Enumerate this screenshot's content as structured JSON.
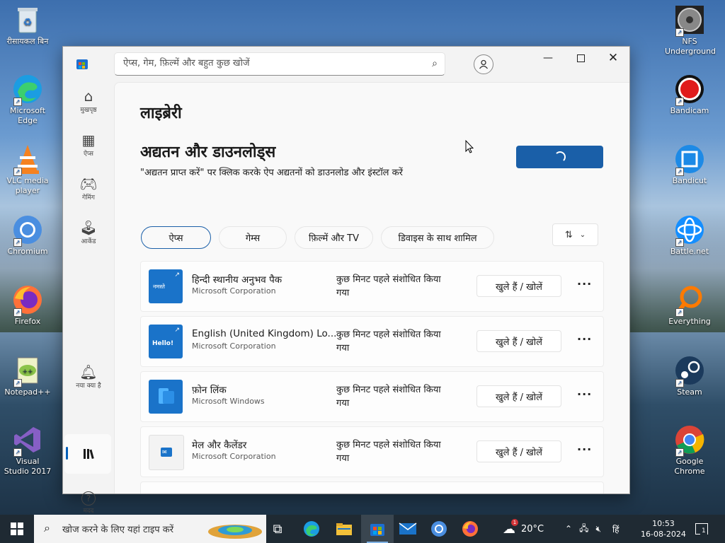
{
  "desktop": {
    "icons_left": [
      {
        "label": "रीसायकल बिन",
        "icon": "recycle-bin-icon"
      },
      {
        "label": "Microsoft Edge",
        "icon": "edge-icon"
      },
      {
        "label": "VLC media player",
        "icon": "vlc-icon"
      },
      {
        "label": "Chromium",
        "icon": "chromium-icon"
      },
      {
        "label": "Firefox",
        "icon": "firefox-icon"
      },
      {
        "label": "Notepad++",
        "icon": "notepadpp-icon"
      },
      {
        "label": "Visual Studio 2017",
        "icon": "visual-studio-icon"
      }
    ],
    "icons_right": [
      {
        "label": "NFS Underground",
        "icon": "nfs-icon"
      },
      {
        "label": "Bandicam",
        "icon": "bandicam-icon"
      },
      {
        "label": "Bandicut",
        "icon": "bandicut-icon"
      },
      {
        "label": "Battle.net",
        "icon": "battlenet-icon"
      },
      {
        "label": "Everything",
        "icon": "everything-icon"
      },
      {
        "label": "Steam",
        "icon": "steam-icon"
      },
      {
        "label": "Google Chrome",
        "icon": "chrome-icon"
      }
    ]
  },
  "window": {
    "search_placeholder": "ऐप्स, गेम, फ़िल्में और बहुत कुछ खोजें",
    "nav": {
      "home": "मुखपृष्ठ",
      "apps": "ऐप्स",
      "gaming": "गेमिंग",
      "arcade": "आर्केड",
      "whats_new": "नया क्या है",
      "help": "मदद"
    },
    "page_title": "लाइब्रेरी",
    "section_title": "अद्यतन और डाउनलोड्स",
    "section_subtitle": "\"अद्यतन प्राप्त करें\" पर क्लिक करके ऐप अद्यतनों को डाउनलोड और इंस्टॉल करें",
    "filters": [
      "ऐप्स",
      "गेम्स",
      "फ़िल्में और TV",
      "डिवाइस के साथ शामिल"
    ],
    "active_filter": "ऐप्स",
    "apps": [
      {
        "name": "हिन्दी स्थानीय अनुभव पैक",
        "publisher": "Microsoft Corporation",
        "modified": "कुछ मिनट पहले संशोधित किया गया",
        "action": "खुले हैं / खोलें",
        "icon_text": "नमस्ते"
      },
      {
        "name": "English (United Kingdom) Lo...",
        "publisher": "Microsoft Corporation",
        "modified": "कुछ मिनट पहले संशोधित किया गया",
        "action": "खुले हैं / खोलें",
        "icon_text": "Hello!"
      },
      {
        "name": "फ़ोन लिंक",
        "publisher": "Microsoft Windows",
        "modified": "कुछ मिनट पहले संशोधित किया गया",
        "action": "खुले हैं / खोलें",
        "icon_text": ""
      },
      {
        "name": "मेल और कैलेंडर",
        "publisher": "Microsoft Corporation",
        "modified": "कुछ मिनट पहले संशोधित किया गया",
        "action": "खुले हैं / खोलें",
        "icon_text": ""
      }
    ]
  },
  "taskbar": {
    "search_placeholder": "खोज करने के लिए यहां टाइप करें",
    "weather_temp": "20°C",
    "weather_badge": "1",
    "language": "हिं",
    "time": "10:53",
    "date": "16-08-2024",
    "notification_count": "1"
  },
  "colors": {
    "accent": "#1a5fa8",
    "taskbar": "#1f2a33"
  }
}
